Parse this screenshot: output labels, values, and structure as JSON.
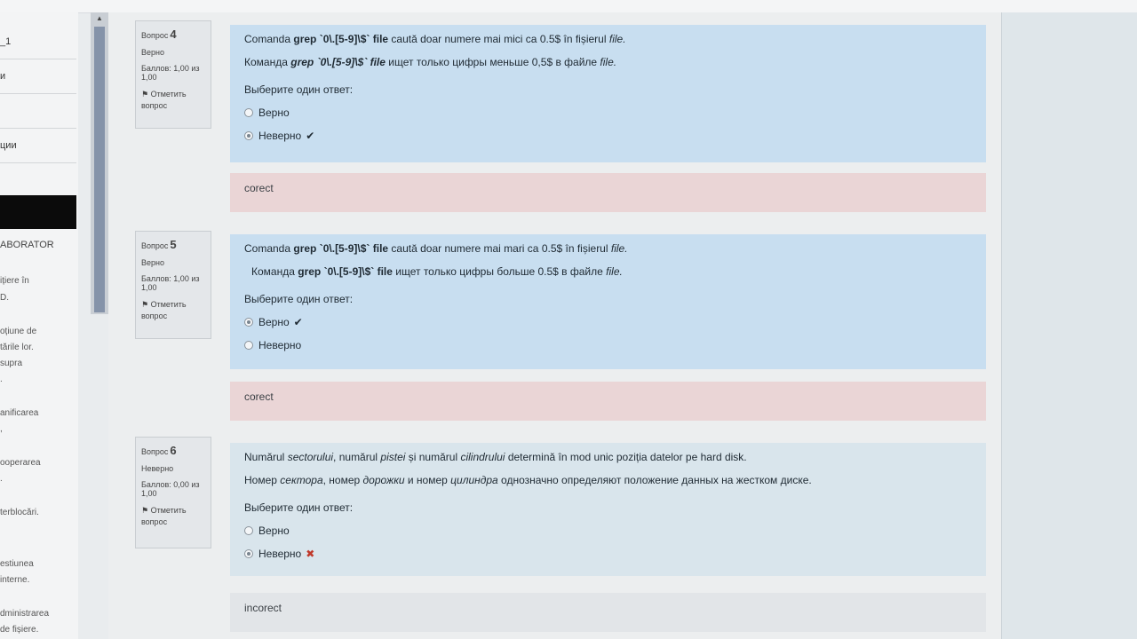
{
  "sidebar": {
    "items": [
      "_1",
      "и",
      "",
      "ции",
      ""
    ],
    "section_heading": "ABORATOR",
    "texts": [
      "ițiere în",
      "D.",
      "oțiune de",
      "tările lor.",
      "supra",
      ".",
      "anificarea",
      ",",
      "ooperarea",
      ".",
      "terblocări.",
      "estiunea",
      "interne.",
      "dministrarea",
      "de fișiere."
    ],
    "scroll_up_icon": "▲"
  },
  "questions": [
    {
      "label": "Вопрос",
      "number": "4",
      "state": "Верно",
      "grade": "Баллов: 1,00 из 1,00",
      "flag": "Отметить вопрос",
      "text_ro": {
        "a": "Comanda ",
        "b": "grep",
        "c": " `0\\.[5-9]\\$` file",
        "d": " caută doar numere mai mici ca 0.5$ în fișierul ",
        "e": "file."
      },
      "text_ru": {
        "a": "Команда ",
        "b": "grep",
        "c": " `0\\.[5-9]\\$` file",
        "d": " ищет только цифры меньше 0,5$ в файле ",
        "e": "file."
      },
      "prompt": "Выберите один ответ:",
      "options": [
        {
          "label": "Верно"
        },
        {
          "label": "Неверно"
        }
      ],
      "feedback": "corect"
    },
    {
      "label": "Вопрос",
      "number": "5",
      "state": "Верно",
      "grade": "Баллов: 1,00 из 1,00",
      "flag": "Отметить вопрос",
      "text_ro": {
        "a": "Comanda ",
        "b": "grep",
        "c": " `0\\.[5-9]\\$` file",
        "d": " caută doar numere mai mari ca 0.5$ în fișierul ",
        "e": "file."
      },
      "text_ru": {
        "a": "Команда ",
        "b": "grep",
        "c": " `0\\.[5-9]\\$` file",
        "d": " ищет только цифры больше 0.5$ в файле ",
        "e": "file."
      },
      "prompt": "Выберите один ответ:",
      "options": [
        {
          "label": "Верно"
        },
        {
          "label": "Неверно"
        }
      ],
      "feedback": "corect"
    },
    {
      "label": "Вопрос",
      "number": "6",
      "state": "Неверно",
      "grade": "Баллов: 0,00 из 1,00",
      "flag": "Отметить вопрос",
      "text_ro": {
        "a": "Numărul ",
        "b": "sectorului",
        "c": ", numărul ",
        "d": "pistei",
        "e": " și numărul ",
        "f": "cilindrului",
        "g": " determină în mod unic poziția datelor pe hard disk."
      },
      "text_ru": {
        "a": "Номер ",
        "b": "сектора",
        "c": ", номер ",
        "d": "дорожки",
        "e": " и номер ",
        "f": "цилиндра",
        "g": " однозначно определяют положение данных на жестком диске."
      },
      "prompt": "Выберите один ответ:",
      "options": [
        {
          "label": "Верно"
        },
        {
          "label": "Неверно"
        }
      ],
      "feedback": "incorect"
    }
  ],
  "icons": {
    "check": "✔",
    "cross": "✖",
    "flag": "⚑"
  }
}
